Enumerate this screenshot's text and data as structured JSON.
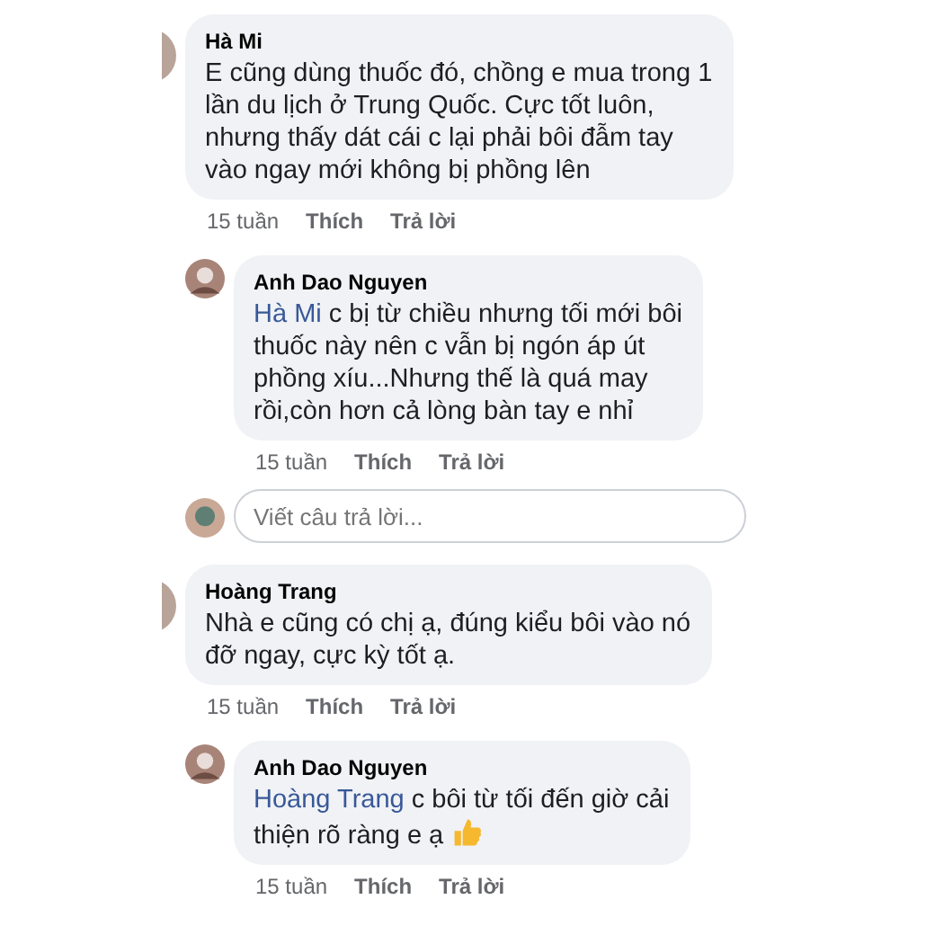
{
  "threads": [
    {
      "comment": {
        "author": "Hà Mi",
        "text": "E cũng dùng thuốc đó, chồng e mua trong 1\nlần du lịch ở Trung Quốc. Cực tốt luôn,\nnhưng thấy dát cái c lại phải bôi đẫm tay\nvào ngay mới không bị phồng lên",
        "time": "15 tuần",
        "like": "Thích",
        "reply": "Trả lời"
      },
      "replies": [
        {
          "author": "Anh Dao Nguyen",
          "mention": "Hà Mi",
          "text": " c bị từ chiều nhưng tối mới bôi\nthuốc này nên c vẫn bị ngón áp út\nphồng xíu...Nhưng thế là quá may\nrồi,còn hơn cả lòng bàn tay e nhỉ",
          "emoji": false,
          "time": "15 tuần",
          "like": "Thích",
          "reply": "Trả lời"
        }
      ],
      "reply_box": {
        "placeholder": "Viết câu trả lời..."
      }
    },
    {
      "comment": {
        "author": "Hoàng Trang",
        "text": "Nhà e cũng có chị ạ, đúng kiểu bôi vào nó\nđỡ ngay, cực kỳ tốt ạ.",
        "time": "15 tuần",
        "like": "Thích",
        "reply": "Trả lời"
      },
      "replies": [
        {
          "author": "Anh Dao Nguyen",
          "mention": "Hoàng Trang",
          "text": " c bôi từ tối đến giờ cải\nthiện rõ ràng e ạ",
          "emoji": true,
          "time": "15 tuần",
          "like": "Thích",
          "reply": "Trả lời"
        }
      ]
    }
  ]
}
